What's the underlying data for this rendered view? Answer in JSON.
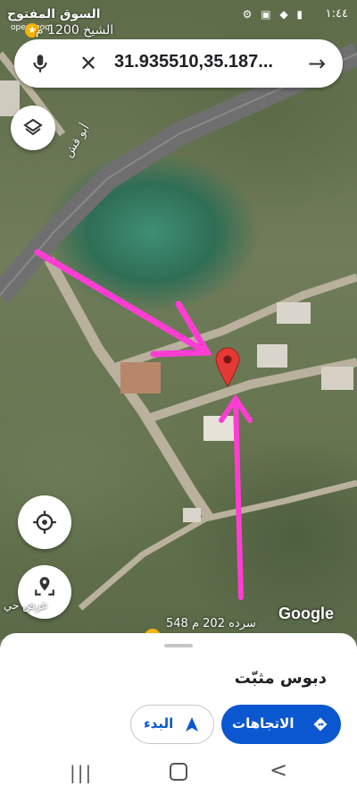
{
  "status_bar": {
    "watermark": "السوق المفتوح",
    "watermark_sub": "opensooq",
    "time": "١:٤٤",
    "icons": [
      "settings-icon",
      "notification-icon",
      "wifi-icon",
      "signal-icon",
      "battery-icon"
    ]
  },
  "map": {
    "top_place_label": "الشيخ 1200 م",
    "road_label": "أبو قش",
    "google_logo": "Google",
    "scale_label": "سرده 202 م 548",
    "street_view_label": "عرض حي",
    "pin_color": "#e53935",
    "arrow_color": "#ff3dd3"
  },
  "search": {
    "query": "31.935510,35.187...",
    "mic_icon": "mic-icon",
    "clear_icon": "close-icon",
    "go_icon": "arrow-right-icon"
  },
  "sheet": {
    "title": "دبوس مثبّت",
    "directions_label": "الاتجاهات",
    "start_label": "البدء",
    "accent": "#0b57d0"
  },
  "nav": {
    "recent": "|||",
    "back": "<"
  }
}
